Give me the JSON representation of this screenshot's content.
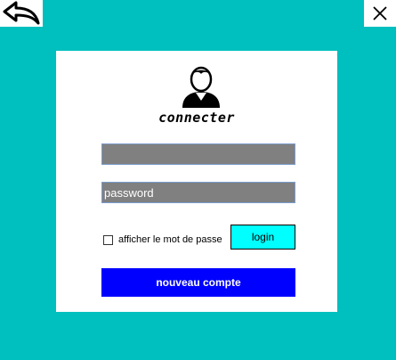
{
  "icons": {
    "back": "back-arrow-icon",
    "close": "close-icon",
    "avatar": "user-avatar-icon"
  },
  "colors": {
    "background": "#00BFBF",
    "card": "#FFFFFF",
    "field": "#808080",
    "login_button": "#00FFFF",
    "new_account_button": "#0000FF"
  },
  "form": {
    "title": "connecter",
    "username_value": "",
    "password_placeholder": "password",
    "show_password_label": "afficher le mot de passe",
    "show_password_checked": false,
    "login_label": "login",
    "new_account_label": "nouveau compte"
  }
}
